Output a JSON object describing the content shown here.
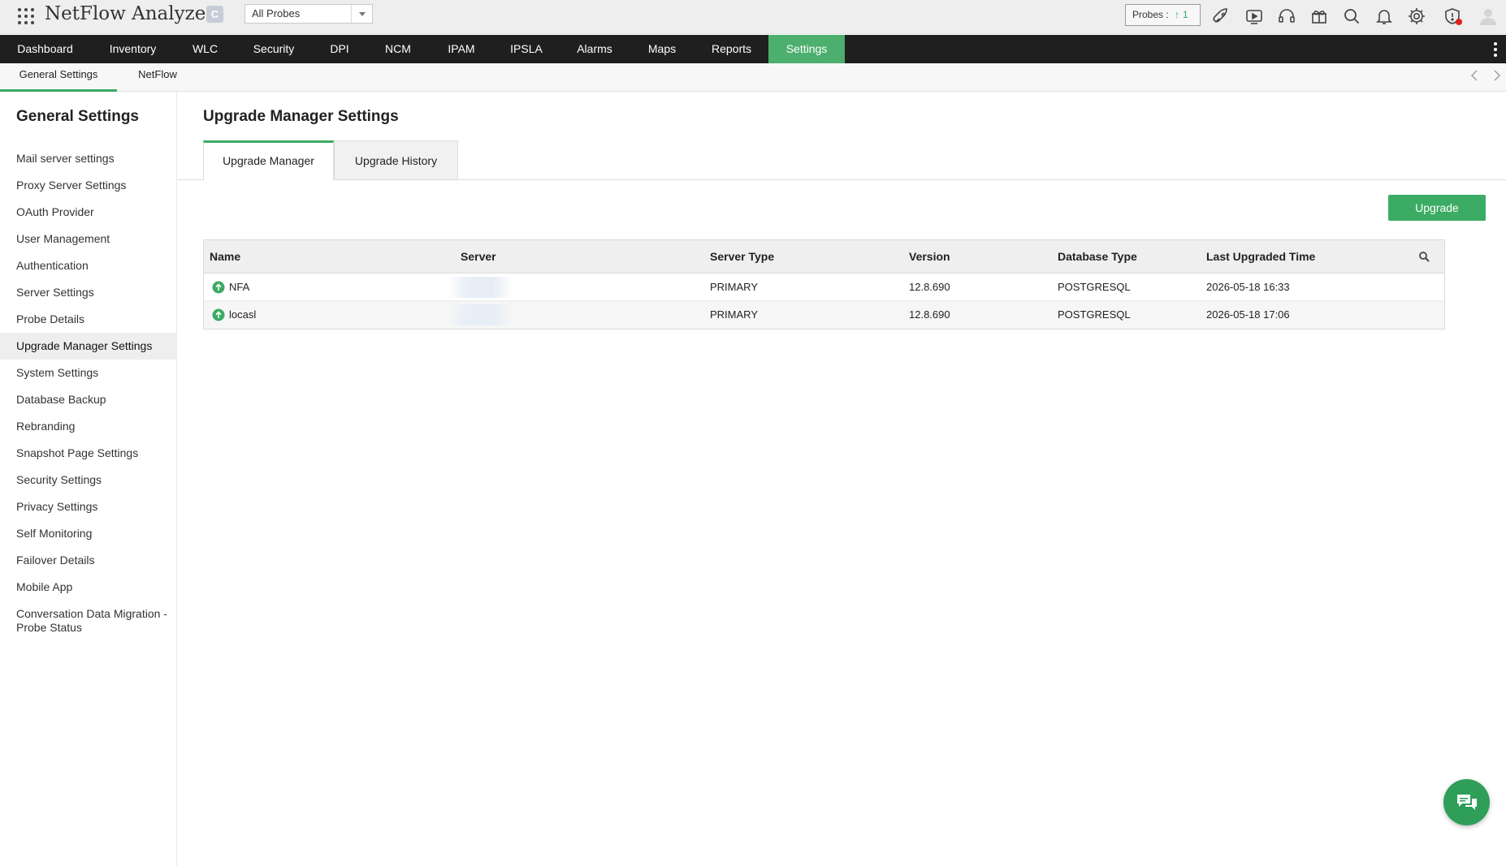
{
  "app": {
    "title": "NetFlow Analyzer",
    "edition_badge": "C",
    "probe_select": "All Probes",
    "probes_label": "Probes :",
    "probes_count": "1"
  },
  "header_icons": [
    "rocket-icon",
    "video-icon",
    "headset-icon",
    "gift-icon",
    "search-icon",
    "bell-icon",
    "gear-icon",
    "shield-alert-icon",
    "user-avatar-icon"
  ],
  "main_nav": {
    "items": [
      "Dashboard",
      "Inventory",
      "WLC",
      "Security",
      "DPI",
      "NCM",
      "IPAM",
      "IPSLA",
      "Alarms",
      "Maps",
      "Reports",
      "Settings"
    ],
    "active": "Settings"
  },
  "sub_nav": {
    "items": [
      "General Settings",
      "NetFlow"
    ],
    "active": "General Settings"
  },
  "sidebar": {
    "title": "General Settings",
    "items": [
      "Mail server settings",
      "Proxy Server Settings",
      "OAuth Provider",
      "User Management",
      "Authentication",
      "Server Settings",
      "Probe Details",
      "Upgrade Manager Settings",
      "System Settings",
      "Database Backup",
      "Rebranding",
      "Snapshot Page Settings",
      "Security Settings",
      "Privacy Settings",
      "Self Monitoring",
      "Failover Details",
      "Mobile App",
      "Conversation Data Migration - Probe Status"
    ],
    "active": "Upgrade Manager Settings"
  },
  "page": {
    "title": "Upgrade Manager Settings",
    "tabs": [
      "Upgrade Manager",
      "Upgrade History"
    ],
    "active_tab": "Upgrade Manager",
    "upgrade_button": "Upgrade"
  },
  "table": {
    "columns": [
      "Name",
      "Server",
      "Server Type",
      "Version",
      "Database Type",
      "Last Upgraded Time"
    ],
    "rows": [
      {
        "name": "NFA",
        "server": "",
        "server_type": "PRIMARY",
        "version": "12.8.690",
        "database_type": "POSTGRESQL",
        "last_upgraded": "2026-05-18 16:33"
      },
      {
        "name": "locasl",
        "server": "",
        "server_type": "PRIMARY",
        "version": "12.8.690",
        "database_type": "POSTGRESQL",
        "last_upgraded": "2026-05-18 17:06"
      }
    ]
  },
  "colors": {
    "accent_green": "#4caf6d",
    "nav_bg": "#1f1f1f",
    "status_up": "#3cab63"
  }
}
